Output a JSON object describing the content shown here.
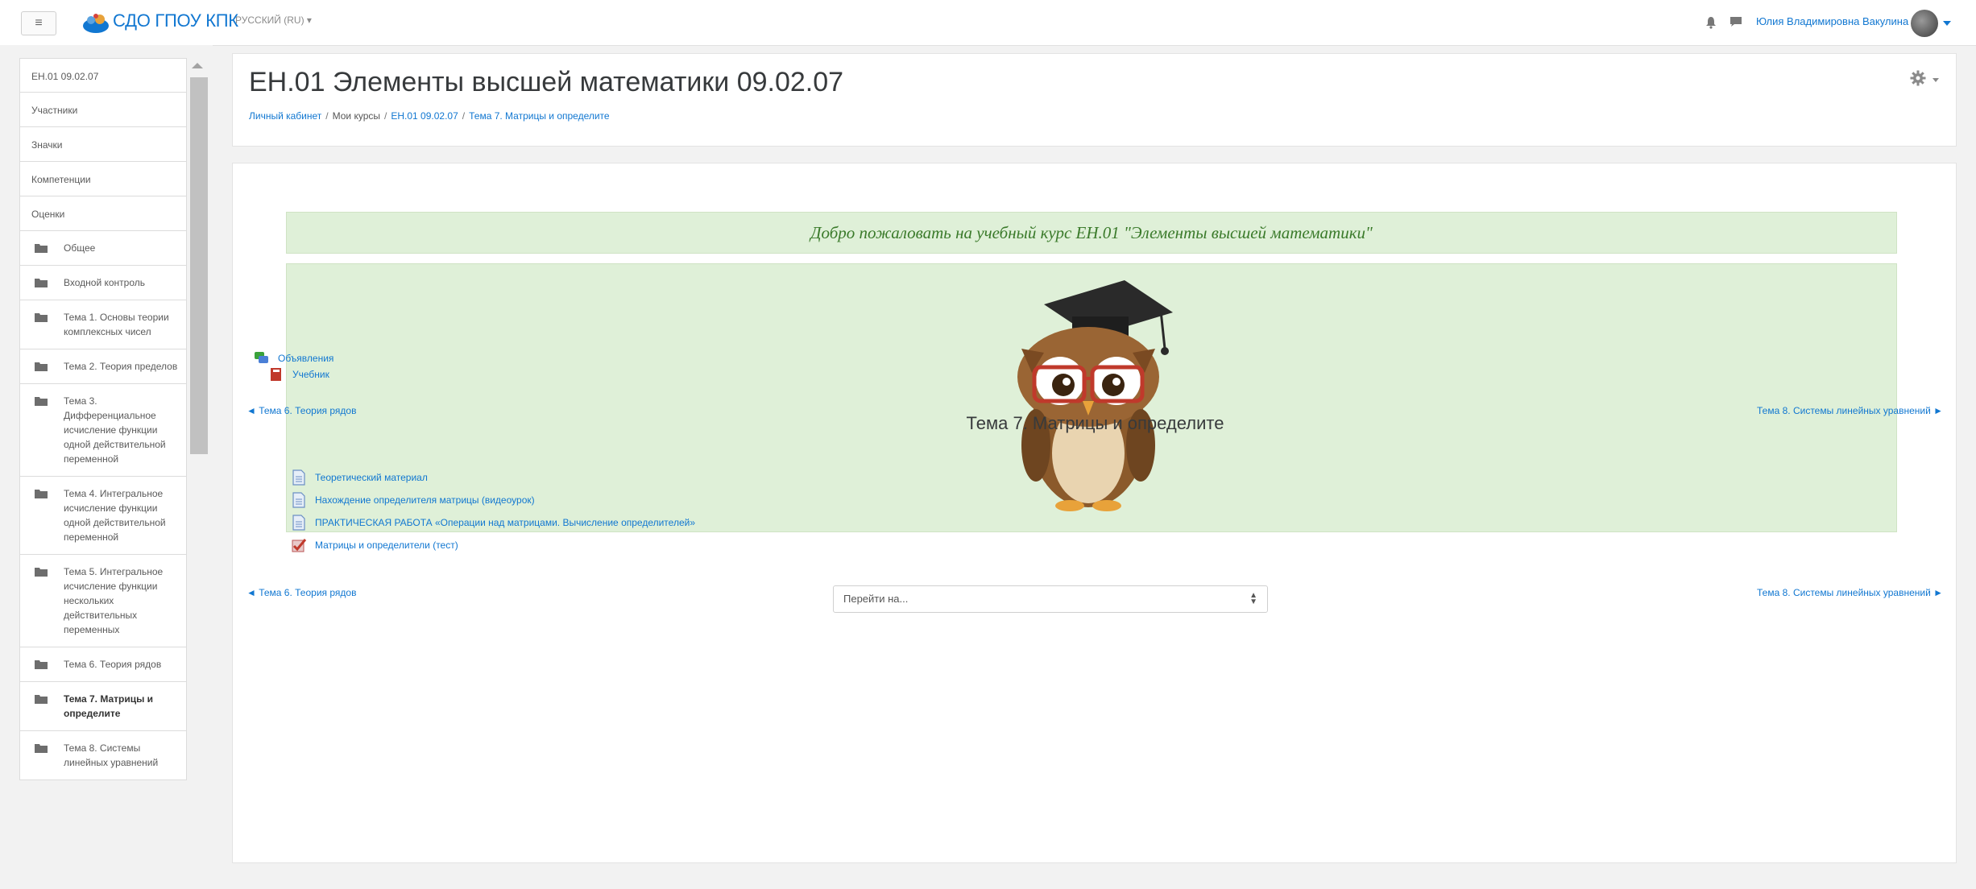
{
  "navbar": {
    "toggle_glyph": "≡",
    "brand": "СДО ГПОУ КПК",
    "language": "РУССКИЙ (RU) ▾",
    "user_name": "Юлия Владимировна Вакулина",
    "icons": [
      "menu-icon",
      "logo-icon",
      "bell-icon",
      "message-icon",
      "avatar",
      "caret-down-icon"
    ]
  },
  "sidebar": {
    "simple_items": [
      "ЕН.01 09.02.07",
      "Участники",
      "Значки",
      "Компетенции",
      "Оценки"
    ],
    "folder_items": [
      {
        "label": "Общее"
      },
      {
        "label": "Входной контроль"
      },
      {
        "label": "Тема 1. Основы теории комплексных чисел"
      },
      {
        "label": "Тема 2. Теория пределов"
      },
      {
        "label": "Тема 3. Дифференциальное исчисление функции одной действительной переменной"
      },
      {
        "label": "Тема 4. Интегральное исчисление функции одной действительной переменной"
      },
      {
        "label": "Тема 5. Интегральное исчисление функции нескольких действительных переменных"
      },
      {
        "label": "Тема 6. Теория рядов"
      },
      {
        "label": "Тема 7. Матрицы и определите",
        "active": true
      },
      {
        "label": "Тема 8. Системы линейных уравнений"
      }
    ]
  },
  "header": {
    "title": "ЕН.01 Элементы высшей математики 09.02.07",
    "breadcrumb": [
      {
        "label": "Личный кабинет",
        "link": true
      },
      {
        "label": "Мои курсы",
        "link": false
      },
      {
        "label": "ЕН.01 09.02.07",
        "link": true
      },
      {
        "label": "Тема 7. Матрицы и определите",
        "link": true
      }
    ],
    "breadcrumb_separator": "/"
  },
  "content": {
    "welcome_text": "Добро пожаловать на учебный курс ЕН.01 \"Элементы высшей математики\"",
    "general_activities": [
      {
        "label": "Объявления",
        "icon": "forum-icon"
      },
      {
        "label": "Учебник",
        "icon": "book-icon"
      }
    ],
    "prev_section": "◄ Тема 6. Теория рядов",
    "next_section": "Тема 8. Системы линейных уравнений ►",
    "section_title": "Тема 7. Матрицы и определите",
    "section_activities": [
      {
        "label": "Теоретический материал",
        "icon": "file-icon"
      },
      {
        "label": "Нахождение определителя матрицы (видеоурок)",
        "icon": "file-icon"
      },
      {
        "label": "ПРАКТИЧЕСКАЯ РАБОТА «Операции над матрицами. Вычисление определителей»",
        "icon": "file-icon"
      },
      {
        "label": "Матрицы и определители (тест)",
        "icon": "quiz-icon"
      }
    ],
    "jump_to": {
      "selected": "Перейти на..."
    }
  },
  "colors": {
    "link": "#1177d1",
    "welcome_bg": "#dff0d8",
    "welcome_text": "#3a7a2a",
    "page_bg": "#f2f2f2"
  }
}
